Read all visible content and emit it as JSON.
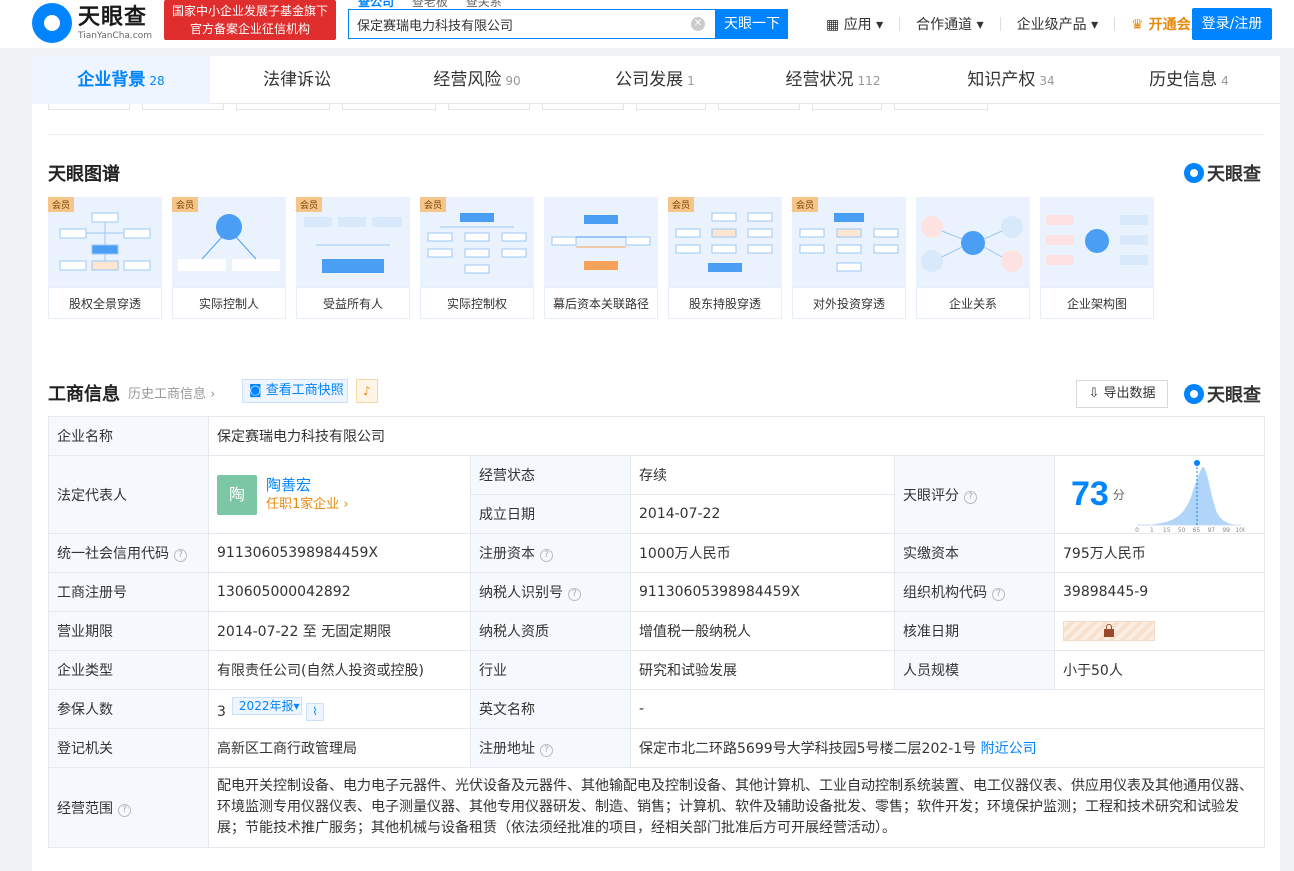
{
  "header": {
    "logo_cn": "天眼查",
    "logo_en": "TianYanCha.com",
    "badge_line1": "国家中小企业发展子基金旗下",
    "badge_line2": "官方备案企业征信机构",
    "search_tabs": [
      "查公司",
      "查老板",
      "查关系"
    ],
    "search_value": "保定赛瑞电力科技有限公司",
    "search_button": "天眼一下",
    "nav": [
      "应用",
      "合作通道",
      "企业级产品"
    ],
    "vip": "开通会员",
    "login": "登录/注册"
  },
  "tabs": [
    {
      "label": "企业背景",
      "count": "28"
    },
    {
      "label": "法律诉讼",
      "count": ""
    },
    {
      "label": "经营风险",
      "count": "90"
    },
    {
      "label": "公司发展",
      "count": "1"
    },
    {
      "label": "经营状况",
      "count": "112"
    },
    {
      "label": "知识产权",
      "count": "34"
    },
    {
      "label": "历史信息",
      "count": "4"
    }
  ],
  "graph_section": {
    "title": "天眼图谱",
    "brand": "天眼查",
    "vip_tag": "会员",
    "cards": [
      "股权全景穿透",
      "实际控制人",
      "受益所有人",
      "实际控制权",
      "幕后资本关联路径",
      "股东持股穿透",
      "对外投资穿透",
      "企业关系",
      "企业架构图"
    ]
  },
  "info_section": {
    "title": "工商信息",
    "history_link": "历史工商信息",
    "snapshot_btn": "查看工商快照",
    "export_btn": "导出数据",
    "brand": "天眼查"
  },
  "info": {
    "company_name_k": "企业名称",
    "company_name_v": "保定赛瑞电力科技有限公司",
    "rep_k": "法定代表人",
    "rep_avatar": "陶",
    "rep_name": "陶善宏",
    "rep_sub": "任职1家企业",
    "status_k": "经营状态",
    "status_v": "存续",
    "founded_k": "成立日期",
    "founded_v": "2014-07-22",
    "score_k": "天眼评分",
    "score_v": "73",
    "score_unit": "分",
    "credit_k": "统一社会信用代码",
    "credit_v": "91130605398984459X",
    "capital_k": "注册资本",
    "capital_v": "1000万人民币",
    "paid_k": "实缴资本",
    "paid_v": "795万人民币",
    "regno_k": "工商注册号",
    "regno_v": "130605000042892",
    "taxid_k": "纳税人识别号",
    "taxid_v": "91130605398984459X",
    "orgcode_k": "组织机构代码",
    "orgcode_v": "39898445-9",
    "term_k": "营业期限",
    "term_v": "2014-07-22 至 无固定期限",
    "taxqual_k": "纳税人资质",
    "taxqual_v": "增值税一般纳税人",
    "approve_k": "核准日期",
    "type_k": "企业类型",
    "type_v": "有限责任公司(自然人投资或控股)",
    "industry_k": "行业",
    "industry_v": "研究和试验发展",
    "staff_k": "人员规模",
    "staff_v": "小于50人",
    "insured_k": "参保人数",
    "insured_v": "3",
    "insured_year": "2022年报",
    "en_k": "英文名称",
    "en_v": "-",
    "authority_k": "登记机关",
    "authority_v": "高新区工商行政管理局",
    "addr_k": "注册地址",
    "addr_v": "保定市北二环路5699号大学科技园5号楼二层202-1号",
    "addr_link": "附近公司",
    "scope_k": "经营范围",
    "scope_v": "配电开关控制设备、电力电子元器件、光伏设备及元器件、其他输配电及控制设备、其他计算机、工业自动控制系统装置、电工仪器仪表、供应用仪表及其他通用仪器、环境监测专用仪器仪表、电子测量仪器、其他专用仪器研发、制造、销售；计算机、软件及辅助设备批发、零售；软件开发；环境保护监测；工程和技术研究和试验发展；节能技术推广服务；其他机械与设备租赁（依法须经批准的项目，经相关部门批准后方可开展经营活动）。"
  },
  "score_chart": {
    "ticks": [
      "0",
      "1",
      "15",
      "50",
      "65",
      "97",
      "99",
      "100"
    ]
  },
  "colors": {
    "accent": "#0084ff",
    "red_badge": "#e02d2d",
    "status_green": "#2aa56b",
    "vip_orange": "#e8890c"
  }
}
